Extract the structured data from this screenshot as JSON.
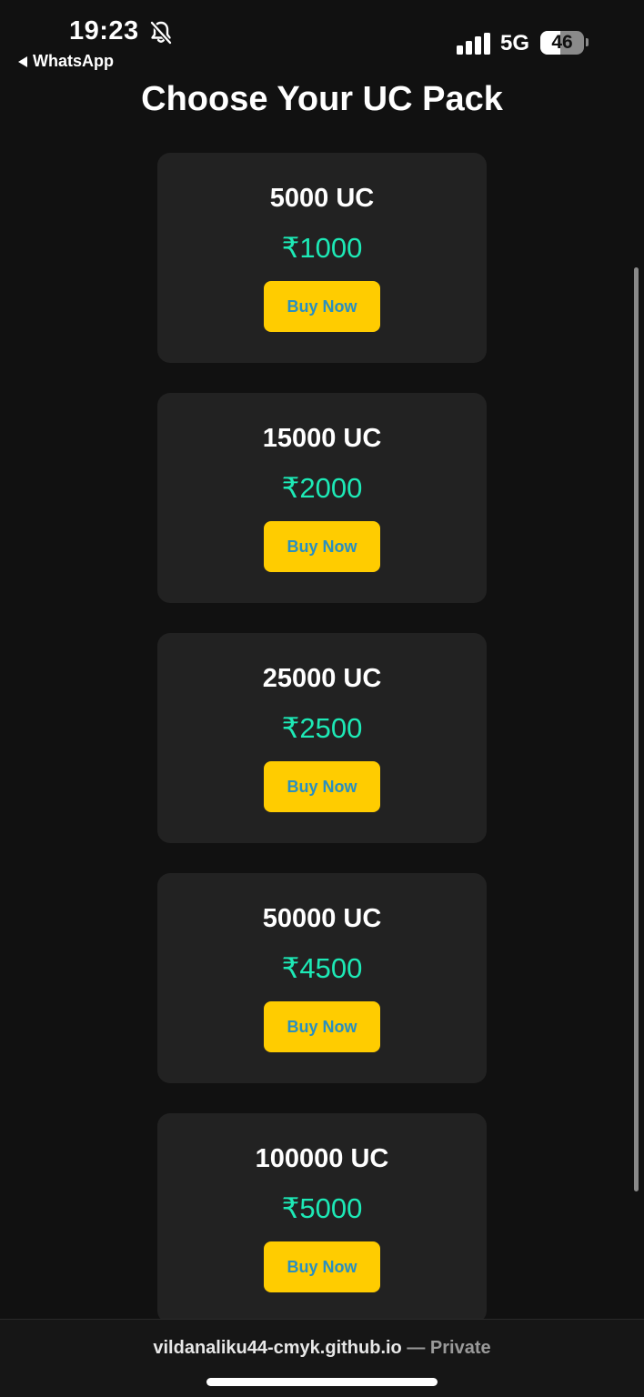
{
  "status_bar": {
    "time": "19:23",
    "back_app": "WhatsApp",
    "network": "5G",
    "battery": "46",
    "battery_level": 0.46
  },
  "page": {
    "title": "Choose Your UC Pack"
  },
  "packs": [
    {
      "amount": "5000 UC",
      "price": "₹1000",
      "button": "Buy Now"
    },
    {
      "amount": "15000 UC",
      "price": "₹2000",
      "button": "Buy Now"
    },
    {
      "amount": "25000 UC",
      "price": "₹2500",
      "button": "Buy Now"
    },
    {
      "amount": "50000 UC",
      "price": "₹4500",
      "button": "Buy Now"
    },
    {
      "amount": "100000 UC",
      "price": "₹5000",
      "button": "Buy Now"
    }
  ],
  "bottom_bar": {
    "domain": "vildanaliku44-cmyk.github.io",
    "separator": "—",
    "privacy": "Private"
  },
  "colors": {
    "background": "#111111",
    "card": "#222222",
    "price": "#1de9b6",
    "button": "#ffcc00",
    "button_text": "#2a8fc0"
  },
  "icons": {
    "bell": "bell-slash-icon",
    "signal": "cellular-signal-icon",
    "back": "back-arrow-icon"
  }
}
